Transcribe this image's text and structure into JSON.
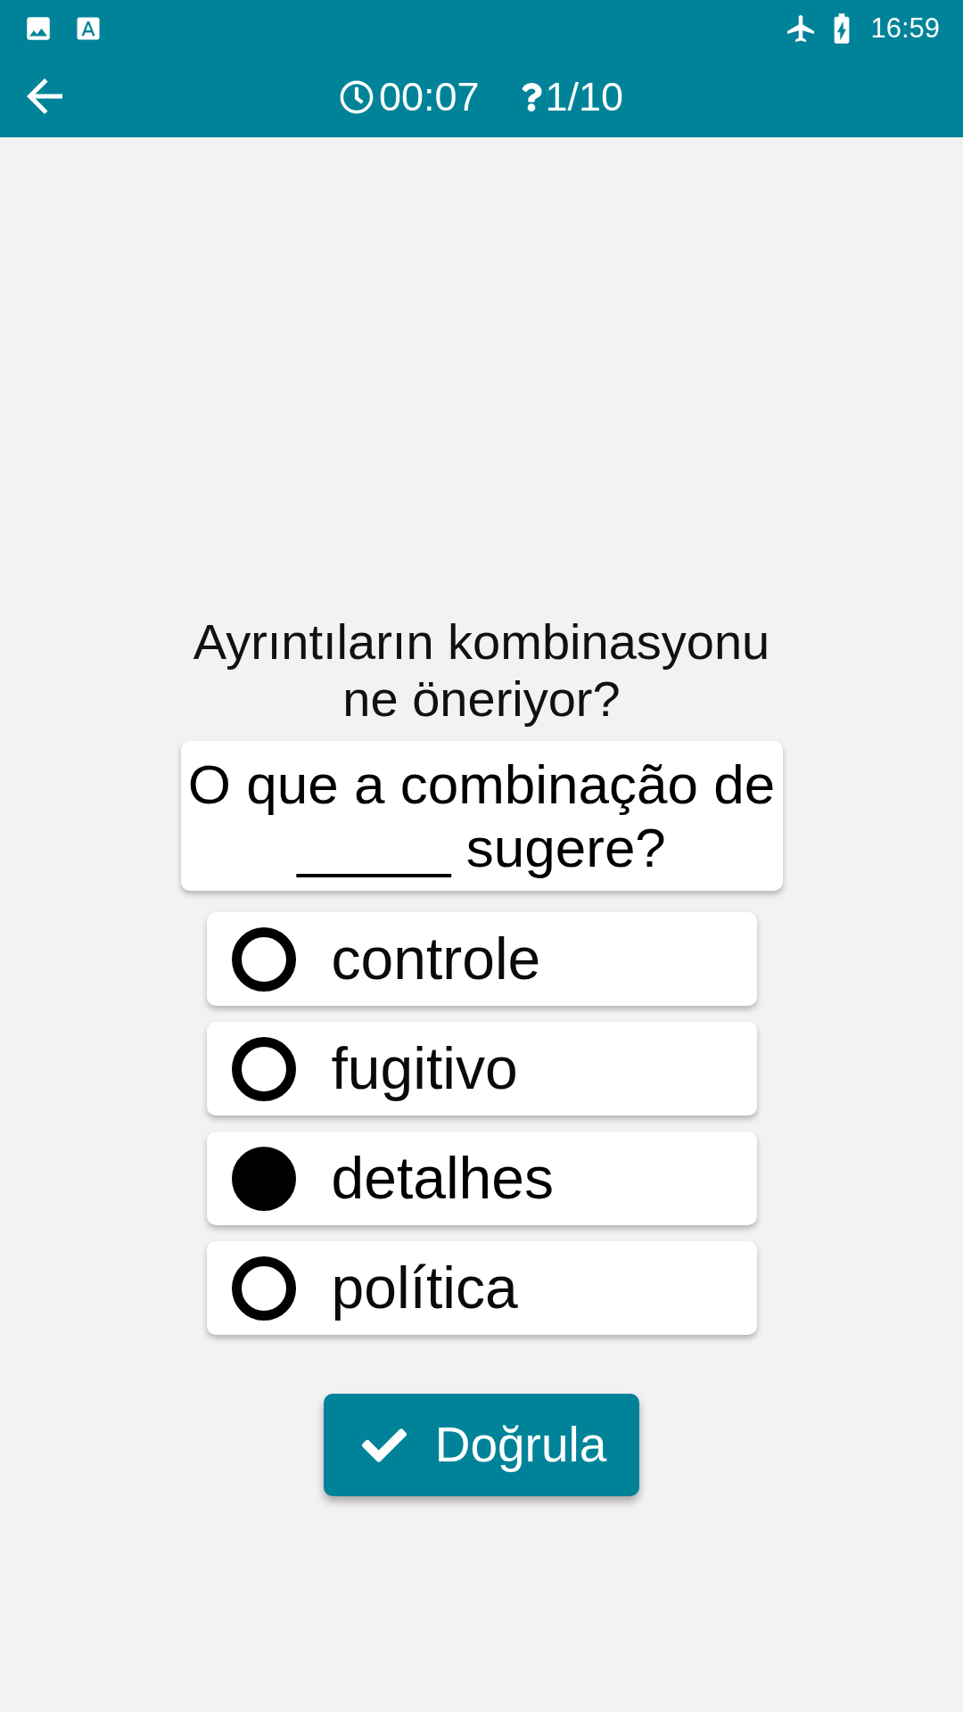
{
  "status_bar": {
    "time": "16:59"
  },
  "app_bar": {
    "timer": "00:07",
    "progress": "1/10"
  },
  "question": {
    "prompt": "Ayrıntıların kombinasyonu ne öneriyor?",
    "sentence": "O que a combinação de _____ sugere?"
  },
  "options": [
    {
      "label": "controle",
      "selected": false
    },
    {
      "label": "fugitivo",
      "selected": false
    },
    {
      "label": "detalhes",
      "selected": true
    },
    {
      "label": "política",
      "selected": false
    }
  ],
  "verify_button": {
    "label": "Doğrula"
  }
}
